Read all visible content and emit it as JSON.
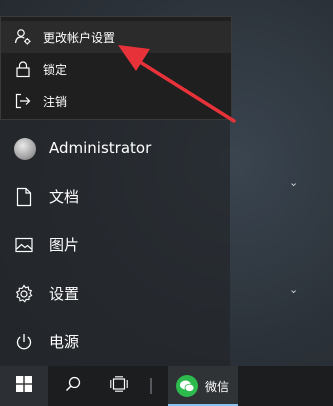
{
  "account_flyout": {
    "items": [
      {
        "label": "更改帐户设置",
        "icon": "account-settings-icon"
      },
      {
        "label": "锁定",
        "icon": "lock-icon"
      },
      {
        "label": "注销",
        "icon": "sign-out-icon"
      }
    ]
  },
  "start_menu": {
    "user": {
      "label": "Administrator"
    },
    "items": [
      {
        "label": "文档",
        "icon": "document-icon"
      },
      {
        "label": "图片",
        "icon": "picture-icon"
      },
      {
        "label": "设置",
        "icon": "gear-icon"
      },
      {
        "label": "电源",
        "icon": "power-icon"
      }
    ]
  },
  "taskbar": {
    "wechat_label": "微信"
  },
  "colors": {
    "annotation_arrow": "#e8323a",
    "wechat_green": "#2dbb4e",
    "taskbar": "#1b1d1f"
  }
}
